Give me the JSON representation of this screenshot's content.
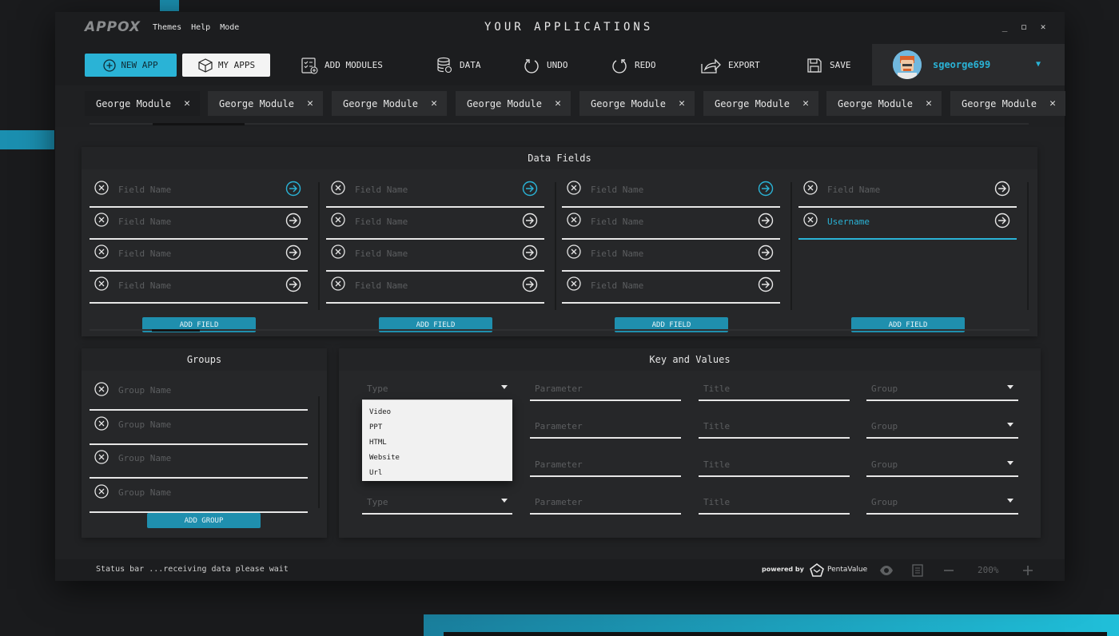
{
  "app": {
    "logo": "APPOX",
    "title": "YOUR APPLICATIONS",
    "menu": [
      "Themes",
      "Help",
      "Mode"
    ]
  },
  "toolbar": {
    "new_app": "NEW APP",
    "my_apps": "MY APPS",
    "add_modules": "ADD MODULES",
    "data": "DATA",
    "undo": "UNDO",
    "redo": "REDO",
    "export": "EXPORT",
    "save": "SAVE"
  },
  "user": {
    "name": "sgeorge699"
  },
  "tabs": [
    "George Module",
    "George Module",
    "George Module",
    "George Module",
    "George Module",
    "George Module",
    "George Module",
    "George Module"
  ],
  "data_fields": {
    "title": "Data Fields",
    "placeholder": "Field Name",
    "active_value": "Username",
    "add_label": "ADD FIELD"
  },
  "groups": {
    "title": "Groups",
    "placeholder": "Group Name",
    "add_label": "ADD GROUP"
  },
  "key_values": {
    "title": "Key and Values",
    "type_placeholder": "Type",
    "parameter_placeholder": "Parameter",
    "title_placeholder": "Title",
    "group_placeholder": "Group",
    "type_options": [
      "Video",
      "PPT",
      "HTML",
      "Website",
      "Url"
    ]
  },
  "status": {
    "text": "Status bar ...receiving data please wait",
    "powered_by": "powered by",
    "brand": "PentaValue",
    "zoom": "200%"
  },
  "colors": {
    "accent": "#2ab3d6",
    "button": "#1f8fae",
    "background": "#202123"
  }
}
